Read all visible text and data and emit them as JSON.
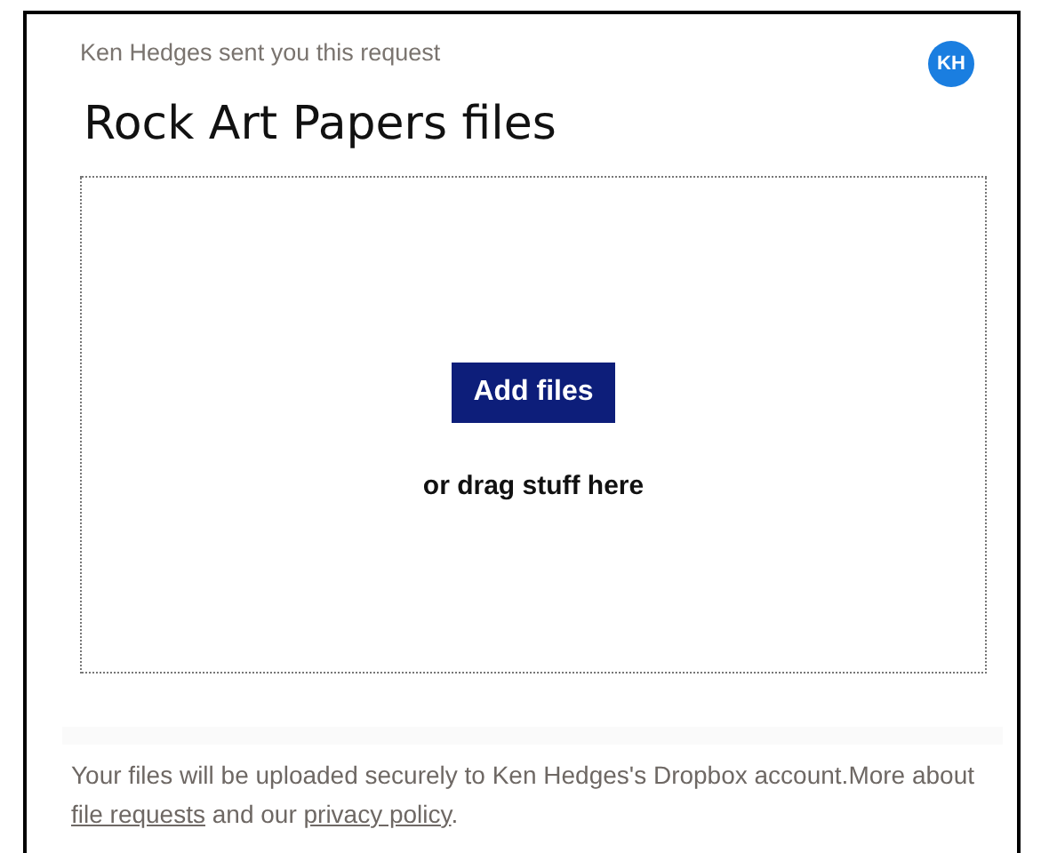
{
  "header": {
    "subtitle": "Ken Hedges sent you this request",
    "avatar": "KH",
    "title": "Rock Art Papers files"
  },
  "dropzone": {
    "button": "Add files",
    "hint": "or drag stuff here"
  },
  "footer": [
    {
      "kind": "text",
      "text": "Your files will be uploaded securely to Ken Hedges's Dropbox account.More about "
    },
    {
      "kind": "link",
      "text": "file requests"
    },
    {
      "kind": "text",
      "text": " and our "
    },
    {
      "kind": "link",
      "text": "privacy policy"
    },
    {
      "kind": "text",
      "text": "."
    }
  ]
}
